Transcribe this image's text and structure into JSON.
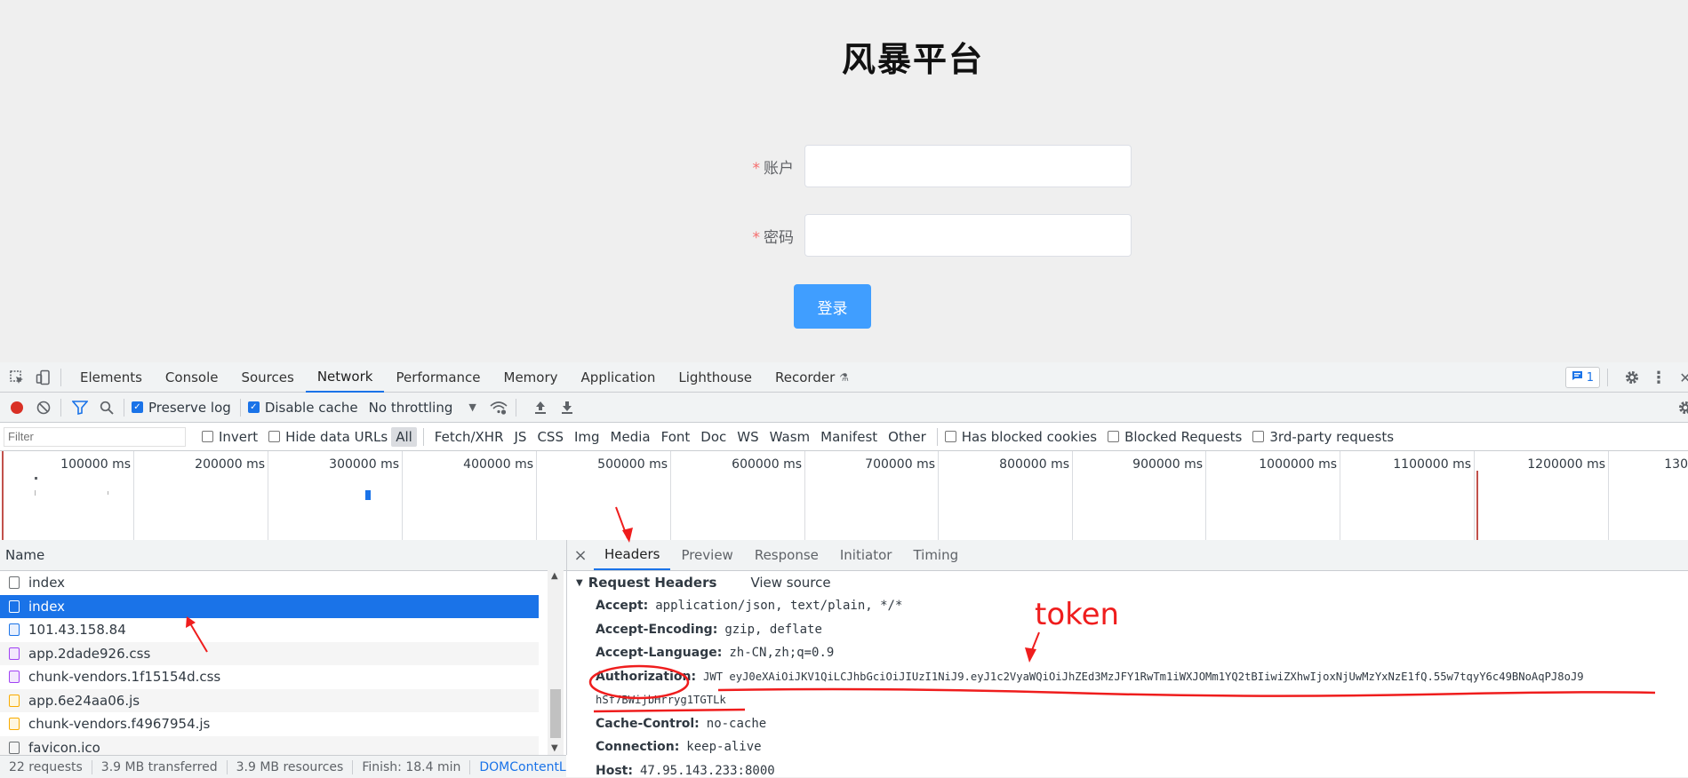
{
  "app": {
    "title": "风暴平台",
    "account_label": "账户",
    "password_label": "密码",
    "required_mark": "*",
    "login_button": "登录",
    "accent_color": "#409eff"
  },
  "devtools": {
    "panel_tabs": [
      "Elements",
      "Console",
      "Sources",
      "Network",
      "Performance",
      "Memory",
      "Application",
      "Lighthouse",
      "Recorder"
    ],
    "active_panel": "Network",
    "issues_count": "1",
    "toolbar": {
      "preserve_log": "Preserve log",
      "disable_cache": "Disable cache",
      "throttling": "No throttling"
    },
    "filter": {
      "placeholder": "Filter",
      "invert": "Invert",
      "hide_data_urls": "Hide data URLs",
      "types": [
        "All",
        "Fetch/XHR",
        "JS",
        "CSS",
        "Img",
        "Media",
        "Font",
        "Doc",
        "WS",
        "Wasm",
        "Manifest",
        "Other"
      ],
      "has_blocked_cookies": "Has blocked cookies",
      "blocked_requests": "Blocked Requests",
      "third_party": "3rd-party requests"
    },
    "timeline_ticks": [
      "100000 ms",
      "200000 ms",
      "300000 ms",
      "400000 ms",
      "500000 ms",
      "600000 ms",
      "700000 ms",
      "800000 ms",
      "900000 ms",
      "1000000 ms",
      "1100000 ms",
      "1200000 ms",
      "130"
    ],
    "list_header": "Name",
    "requests": [
      {
        "name": "index",
        "type": "xhr"
      },
      {
        "name": "index",
        "type": "xhr",
        "selected": true
      },
      {
        "name": "101.43.158.84",
        "type": "doc"
      },
      {
        "name": "app.2dade926.css",
        "type": "css"
      },
      {
        "name": "chunk-vendors.1f15154d.css",
        "type": "css"
      },
      {
        "name": "app.6e24aa06.js",
        "type": "js"
      },
      {
        "name": "chunk-vendors.f4967954.js",
        "type": "js"
      },
      {
        "name": "favicon.ico",
        "type": "other"
      }
    ],
    "status": {
      "requests": "22 requests",
      "transferred": "3.9 MB transferred",
      "resources": "3.9 MB resources",
      "finish": "Finish: 18.4 min",
      "dcl": "DOMContentLoa"
    },
    "detail_tabs": [
      "Headers",
      "Preview",
      "Response",
      "Initiator",
      "Timing"
    ],
    "active_detail_tab": "Headers",
    "section_title": "Request Headers",
    "view_source": "View source",
    "headers": {
      "accept": {
        "name": "Accept:",
        "value": "application/json, text/plain, */*"
      },
      "accept_encoding": {
        "name": "Accept-Encoding:",
        "value": "gzip, deflate"
      },
      "accept_language": {
        "name": "Accept-Language:",
        "value": "zh-CN,zh;q=0.9"
      },
      "authorization": {
        "name": "Authorization:",
        "value": "JWT eyJ0eXAiOiJKV1QiLCJhbGciOiJIUzI1NiJ9.eyJ1c2VyaWQiOiJhZEd3MzJFY1RwTm1iWXJOMm1YQ2tBIiwiZXhwIjoxNjUwMzYxNzE1fQ.55w7tqyY6c49BNoAqPJ8oJ9",
        "value_cont": "hSf7BWijbHrryg1TGTLk"
      },
      "cache_control": {
        "name": "Cache-Control:",
        "value": "no-cache"
      },
      "connection": {
        "name": "Connection:",
        "value": "keep-alive"
      },
      "host": {
        "name": "Host:",
        "value": "47.95.143.233:8000"
      }
    }
  },
  "annotation": {
    "token_label": "token",
    "color": "#ef1d1d"
  }
}
